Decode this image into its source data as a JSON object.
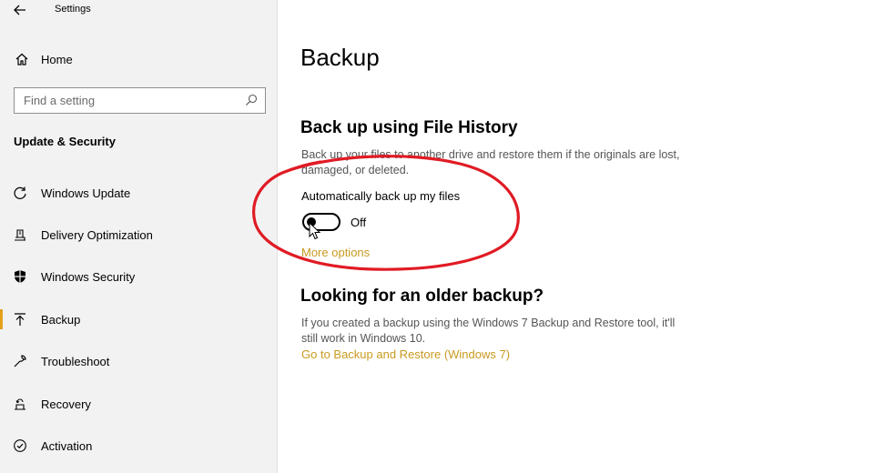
{
  "window": {
    "title": "Settings"
  },
  "sidebar": {
    "home_label": "Home",
    "search_placeholder": "Find a setting",
    "section_title": "Update & Security",
    "items": [
      {
        "label": "Windows Update",
        "icon": "refresh-icon"
      },
      {
        "label": "Delivery Optimization",
        "icon": "delivery-optimization-icon"
      },
      {
        "label": "Windows Security",
        "icon": "shield-icon"
      },
      {
        "label": "Backup",
        "icon": "backup-arrow-icon",
        "selected": true
      },
      {
        "label": "Troubleshoot",
        "icon": "wrench-icon"
      },
      {
        "label": "Recovery",
        "icon": "recovery-icon"
      },
      {
        "label": "Activation",
        "icon": "check-circle-icon"
      }
    ]
  },
  "main": {
    "page_title": "Backup",
    "file_history": {
      "heading": "Back up using File History",
      "description": "Back up your files to another drive and restore them if the originals are lost, damaged, or deleted.",
      "toggle_label": "Automatically back up my files",
      "toggle_state": "Off",
      "more_options": "More options"
    },
    "older_backup": {
      "heading": "Looking for an older backup?",
      "description": "If you created a backup using the Windows 7 Backup and Restore tool, it'll still work in Windows 10.",
      "link": "Go to Backup and Restore (Windows 7)"
    }
  },
  "colors": {
    "accent": "#e3a11c",
    "link": "#c99a1f",
    "annotation": "#e01b24",
    "sidebar_bg": "#f2f2f2"
  }
}
